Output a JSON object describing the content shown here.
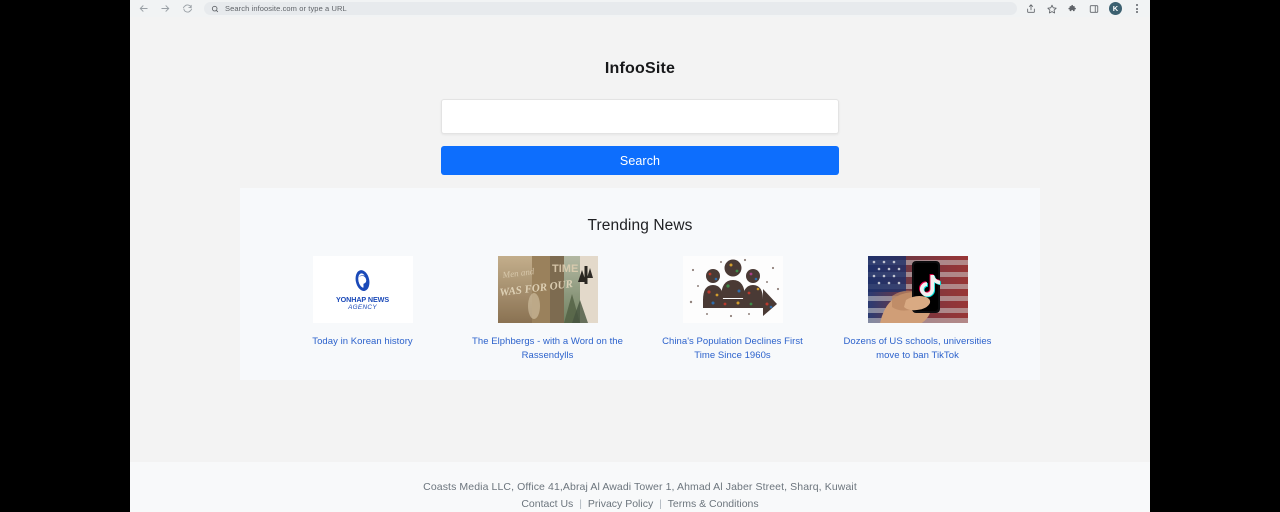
{
  "browser": {
    "back_icon": "back-arrow-icon",
    "forward_icon": "forward-arrow-icon",
    "reload_icon": "reload-icon",
    "omnibox": {
      "search_icon": "search-icon",
      "placeholder": "Search infoosite.com or type a URL",
      "value": ""
    },
    "toolbar_icons": [
      "share-icon",
      "bookmark-star-icon",
      "extensions-puzzle-icon",
      "side-panel-icon"
    ],
    "profile_initial": "K",
    "menu_icon": "kebab-menu-icon"
  },
  "page": {
    "title": "InfooSite",
    "search": {
      "input_value": "",
      "input_placeholder": "",
      "button_label": "Search"
    },
    "trending": {
      "heading": "Trending News",
      "cards": [
        {
          "title": "Today in Korean history",
          "image_name": "yonhap-news-agency-logo",
          "logo_word": "YONHAP NEWS",
          "logo_sub": "AGENCY"
        },
        {
          "title": "The Elphbergs - with a Word on the Rassendylls",
          "image_name": "sepia-collage-photo"
        },
        {
          "title": "China's Population Declines First Time Since 1960s",
          "image_name": "crowd-arrow-photo"
        },
        {
          "title": "Dozens of US schools, universities move to ban TikTok",
          "image_name": "hand-holding-phone-tiktok-us-flag-photo"
        }
      ]
    },
    "footer": {
      "address": "Coasts Media LLC, Office 41,Abraj Al Awadi Tower 1, Ahmad Al Jaber Street, Sharq, Kuwait",
      "links": [
        {
          "label": "Contact Us"
        },
        {
          "label": "Privacy Policy"
        },
        {
          "label": "Terms & Conditions"
        }
      ],
      "separator": "|"
    }
  },
  "colors": {
    "accent_blue": "#0d6efd",
    "link_blue": "#2c62cc",
    "page_bg": "#f3f3f3",
    "section_bg": "#f7f9fb",
    "footer_bg": "#f8f9fa"
  }
}
